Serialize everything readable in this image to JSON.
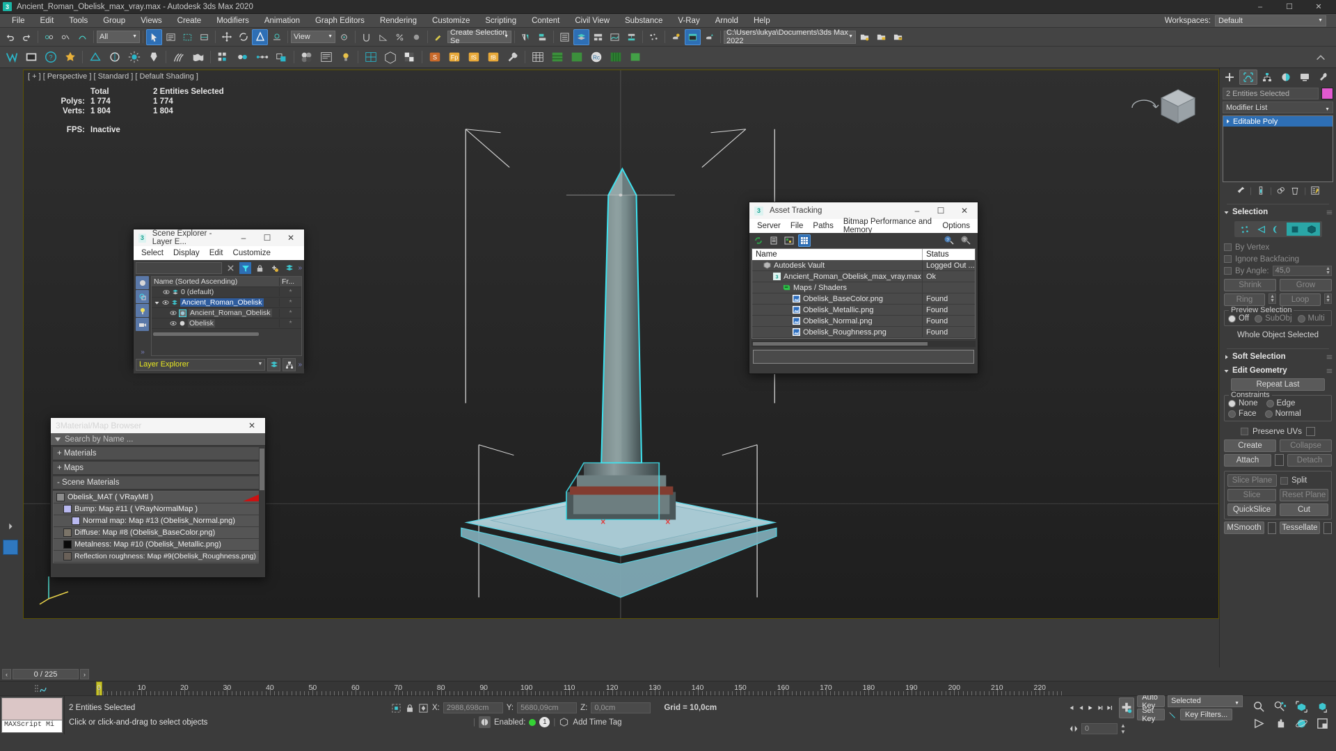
{
  "titlebar": {
    "app_icon": "3dsmax-icon",
    "title": "Ancient_Roman_Obelisk_max_vray.max - Autodesk 3ds Max 2020",
    "minimize": "–",
    "maximize": "☐",
    "close": "✕"
  },
  "menubar": {
    "items": [
      "File",
      "Edit",
      "Tools",
      "Group",
      "Views",
      "Create",
      "Modifiers",
      "Animation",
      "Graph Editors",
      "Rendering",
      "Customize",
      "Scripting",
      "Content",
      "Civil View",
      "Substance",
      "V-Ray",
      "Arnold",
      "Help"
    ],
    "workspaces_label": "Workspaces:",
    "workspaces_value": "Default"
  },
  "toolbar": {
    "selection_filter": "All",
    "view_combo": "View",
    "named_selection_set": "Create Selection Se",
    "project_path": "C:\\Users\\lukya\\Documents\\3ds Max 2022"
  },
  "viewport": {
    "label": "[ + ] [ Perspective ] [ Standard ] [ Default Shading ]",
    "stats": {
      "col_total": "Total",
      "col_selected": "2 Entities Selected",
      "polys_label": "Polys:",
      "polys_total": "1 774",
      "polys_selected": "1 774",
      "verts_label": "Verts:",
      "verts_total": "1 804",
      "verts_selected": "1 804",
      "fps_label": "FPS:",
      "fps_value": "Inactive"
    }
  },
  "scene_explorer": {
    "title": "Scene Explorer - Layer E...",
    "menu": [
      "Select",
      "Display",
      "Edit",
      "Customize"
    ],
    "search_value": "",
    "column_name": "Name (Sorted Ascending)",
    "column_frz": "Fr...",
    "rows": [
      {
        "label": "0 (default)",
        "indent": 1,
        "icon": "layer-icon",
        "frozen": "*"
      },
      {
        "label": "Ancient_Roman_Obelisk",
        "indent": 0,
        "icon": "layer-icon",
        "frozen": "*"
      },
      {
        "label": "Ancient_Roman_Obelisk",
        "indent": 2,
        "icon": "object-icon",
        "frozen": "*"
      },
      {
        "label": "Obelisk",
        "indent": 2,
        "icon": "sphere-icon",
        "frozen": "*"
      }
    ],
    "footer_combo": "Layer Explorer"
  },
  "asset_tracking": {
    "title": "Asset Tracking",
    "menu": [
      "Server",
      "File",
      "Paths",
      "Bitmap Performance and Memory",
      "Options"
    ],
    "col_name": "Name",
    "col_status": "Status",
    "rows": [
      {
        "name": "Autodesk Vault",
        "status": "Logged Out ...",
        "indent": 0,
        "icon": "vault-icon"
      },
      {
        "name": "Ancient_Roman_Obelisk_max_vray.max",
        "status": "Ok",
        "indent": 1,
        "icon": "max-file-icon"
      },
      {
        "name": "Maps / Shaders",
        "status": "",
        "indent": 1,
        "icon": "maps-icon"
      },
      {
        "name": "Obelisk_BaseColor.png",
        "status": "Found",
        "indent": 2,
        "icon": "image-icon"
      },
      {
        "name": "Obelisk_Metallic.png",
        "status": "Found",
        "indent": 2,
        "icon": "image-icon"
      },
      {
        "name": "Obelisk_Normal.png",
        "status": "Found",
        "indent": 2,
        "icon": "image-icon"
      },
      {
        "name": "Obelisk_Roughness.png",
        "status": "Found",
        "indent": 2,
        "icon": "image-icon"
      }
    ]
  },
  "material_browser": {
    "title": "Material/Map Browser",
    "search_placeholder": "Search by Name ...",
    "sections": [
      "+ Materials",
      "+ Maps",
      "- Scene Materials"
    ],
    "items": [
      {
        "label": "Obelisk_MAT  ( VRayMtl )",
        "indent": 0,
        "swatch": "#8c8c8c"
      },
      {
        "label": "Bump: Map #11  ( VRayNormalMap )",
        "indent": 1,
        "swatch": "#b9b9f0"
      },
      {
        "label": "Normal map: Map #13 (Obelisk_Normal.png)",
        "indent": 2,
        "swatch": "#b9b9f0"
      },
      {
        "label": "Diffuse: Map #8 (Obelisk_BaseColor.png)",
        "indent": 1,
        "swatch": "#7b7468"
      },
      {
        "label": "Metalness: Map #10 (Obelisk_Metallic.png)",
        "indent": 1,
        "swatch": "#0a0a0a"
      },
      {
        "label": "Reflection roughness: Map #9(Obelisk_Roughness.png)",
        "indent": 1,
        "swatch": "#696058"
      }
    ]
  },
  "command_panel": {
    "tabs": [
      "create-tab",
      "modify-tab",
      "hierarchy-tab",
      "motion-tab",
      "display-tab",
      "utilities-tab"
    ],
    "active_tab_index": 1,
    "object_name": "2 Entities Selected",
    "object_color": "#e25ad0",
    "modifier_list_label": "Modifier List",
    "stack": [
      {
        "label": "Editable Poly",
        "selected": true
      }
    ],
    "selection": {
      "title": "Selection",
      "sub_object_modes": [
        "vertex",
        "edge",
        "border",
        "polygon",
        "element"
      ],
      "active_modes": [
        "polygon",
        "element"
      ],
      "by_vertex": "By Vertex",
      "ignore_backfacing": "Ignore Backfacing",
      "by_angle": "By Angle:",
      "by_angle_value": "45,0",
      "shrink": "Shrink",
      "grow": "Grow",
      "ring": "Ring",
      "loop": "Loop",
      "preview_selection": "Preview Selection",
      "preview_off": "Off",
      "preview_subobj": "SubObj",
      "preview_multi": "Multi",
      "status": "Whole Object Selected"
    },
    "soft_selection": {
      "title": "Soft Selection"
    },
    "edit_geometry": {
      "title": "Edit Geometry",
      "repeat_last": "Repeat Last",
      "constraints_title": "Constraints",
      "constraint_none": "None",
      "constraint_edge": "Edge",
      "constraint_face": "Face",
      "constraint_normal": "Normal",
      "preserve_uvs": "Preserve UVs",
      "create": "Create",
      "collapse": "Collapse",
      "attach": "Attach",
      "detach": "Detach",
      "slice_plane": "Slice Plane",
      "split": "Split",
      "slice": "Slice",
      "reset_plane": "Reset Plane",
      "quickslice": "QuickSlice",
      "cut": "Cut",
      "msmooth": "MSmooth",
      "tessellate": "Tessellate"
    }
  },
  "timebar": {
    "current_frame": "0 / 225",
    "prev": "‹",
    "next": "›",
    "ruler_labels": [
      "0",
      "10",
      "20",
      "30",
      "40",
      "50",
      "60",
      "70",
      "80",
      "90",
      "100",
      "110",
      "120",
      "130",
      "140",
      "150",
      "160",
      "170",
      "180",
      "190",
      "200",
      "210",
      "220"
    ]
  },
  "statusbar": {
    "maxscript_label": "MAXScript Mi",
    "selection_status": "2 Entities Selected",
    "prompt": "Click or click-and-drag to select objects",
    "x_label": "X:",
    "x_value": "2988,698cm",
    "y_label": "Y:",
    "y_value": "5680,09cm",
    "z_label": "Z:",
    "z_value": "0,0cm",
    "grid": "Grid = 10,0cm",
    "enabled_label": "Enabled:",
    "enabled_count": "1",
    "add_time_tag": "Add Time Tag",
    "auto_key": "Auto Key",
    "set_key": "Set Key",
    "key_filters": "Key Filters...",
    "key_mode_selected": "Selected",
    "frame_field": "0"
  }
}
